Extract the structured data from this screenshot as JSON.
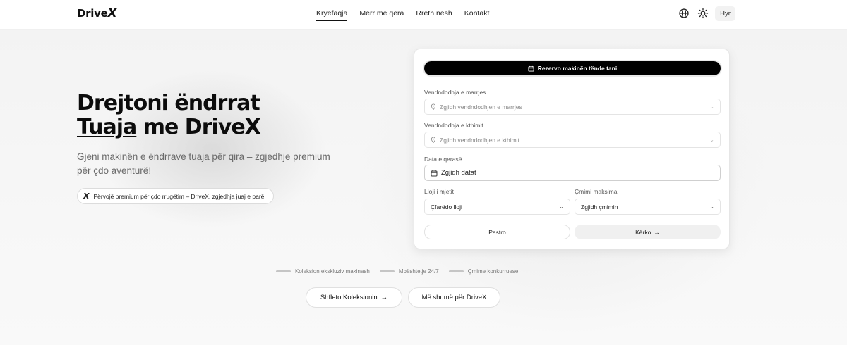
{
  "header": {
    "logo_main": "Drive",
    "logo_x": "X",
    "nav": [
      "Kryefaqja",
      "Merr me qera",
      "Rreth nesh",
      "Kontakt"
    ],
    "active_nav": "Kryefaqja",
    "login_label": "Hyr",
    "icons": [
      "globe-icon",
      "sun-icon"
    ]
  },
  "hero": {
    "title_line1": "Drejtoni ëndrrat",
    "title_underlined": "Tuaja",
    "title_line2_rest": " me DriveX",
    "subtitle": "Gjeni makinën e ëndrrave tuaja për qira – zgjedhje premium për çdo aventurë!",
    "pill_icon": "X",
    "pill_text": "Përvojë premium për çdo rrugëtim – DriveX, zgjedhja juaj e parë!"
  },
  "booking": {
    "reserve_label": "Rezervo makinën tënde tani",
    "pickup_label": "Vendndodhja e marrjes",
    "pickup_placeholder": "Zgjidh vendndodhjen e marrjes",
    "return_label": "Vendndodhja e kthimit",
    "return_placeholder": "Zgjidh vendndodhjen e kthimit",
    "date_label": "Data e qerasë",
    "date_placeholder": "Zgjidh datat",
    "type_label": "Lloji i mjetit",
    "type_value": "Çfarëdo lloji",
    "price_label": "Çmimi maksimal",
    "price_value": "Zgjidh çmimin",
    "clear_label": "Pastro",
    "search_label": "Kërko"
  },
  "features": [
    "Koleksion ekskluziv makinash",
    "Mbështetje 24/7",
    "Çmime konkurruese"
  ],
  "cta": {
    "primary": "Shfleto Koleksionin",
    "secondary": "Më shumë për DriveX"
  }
}
